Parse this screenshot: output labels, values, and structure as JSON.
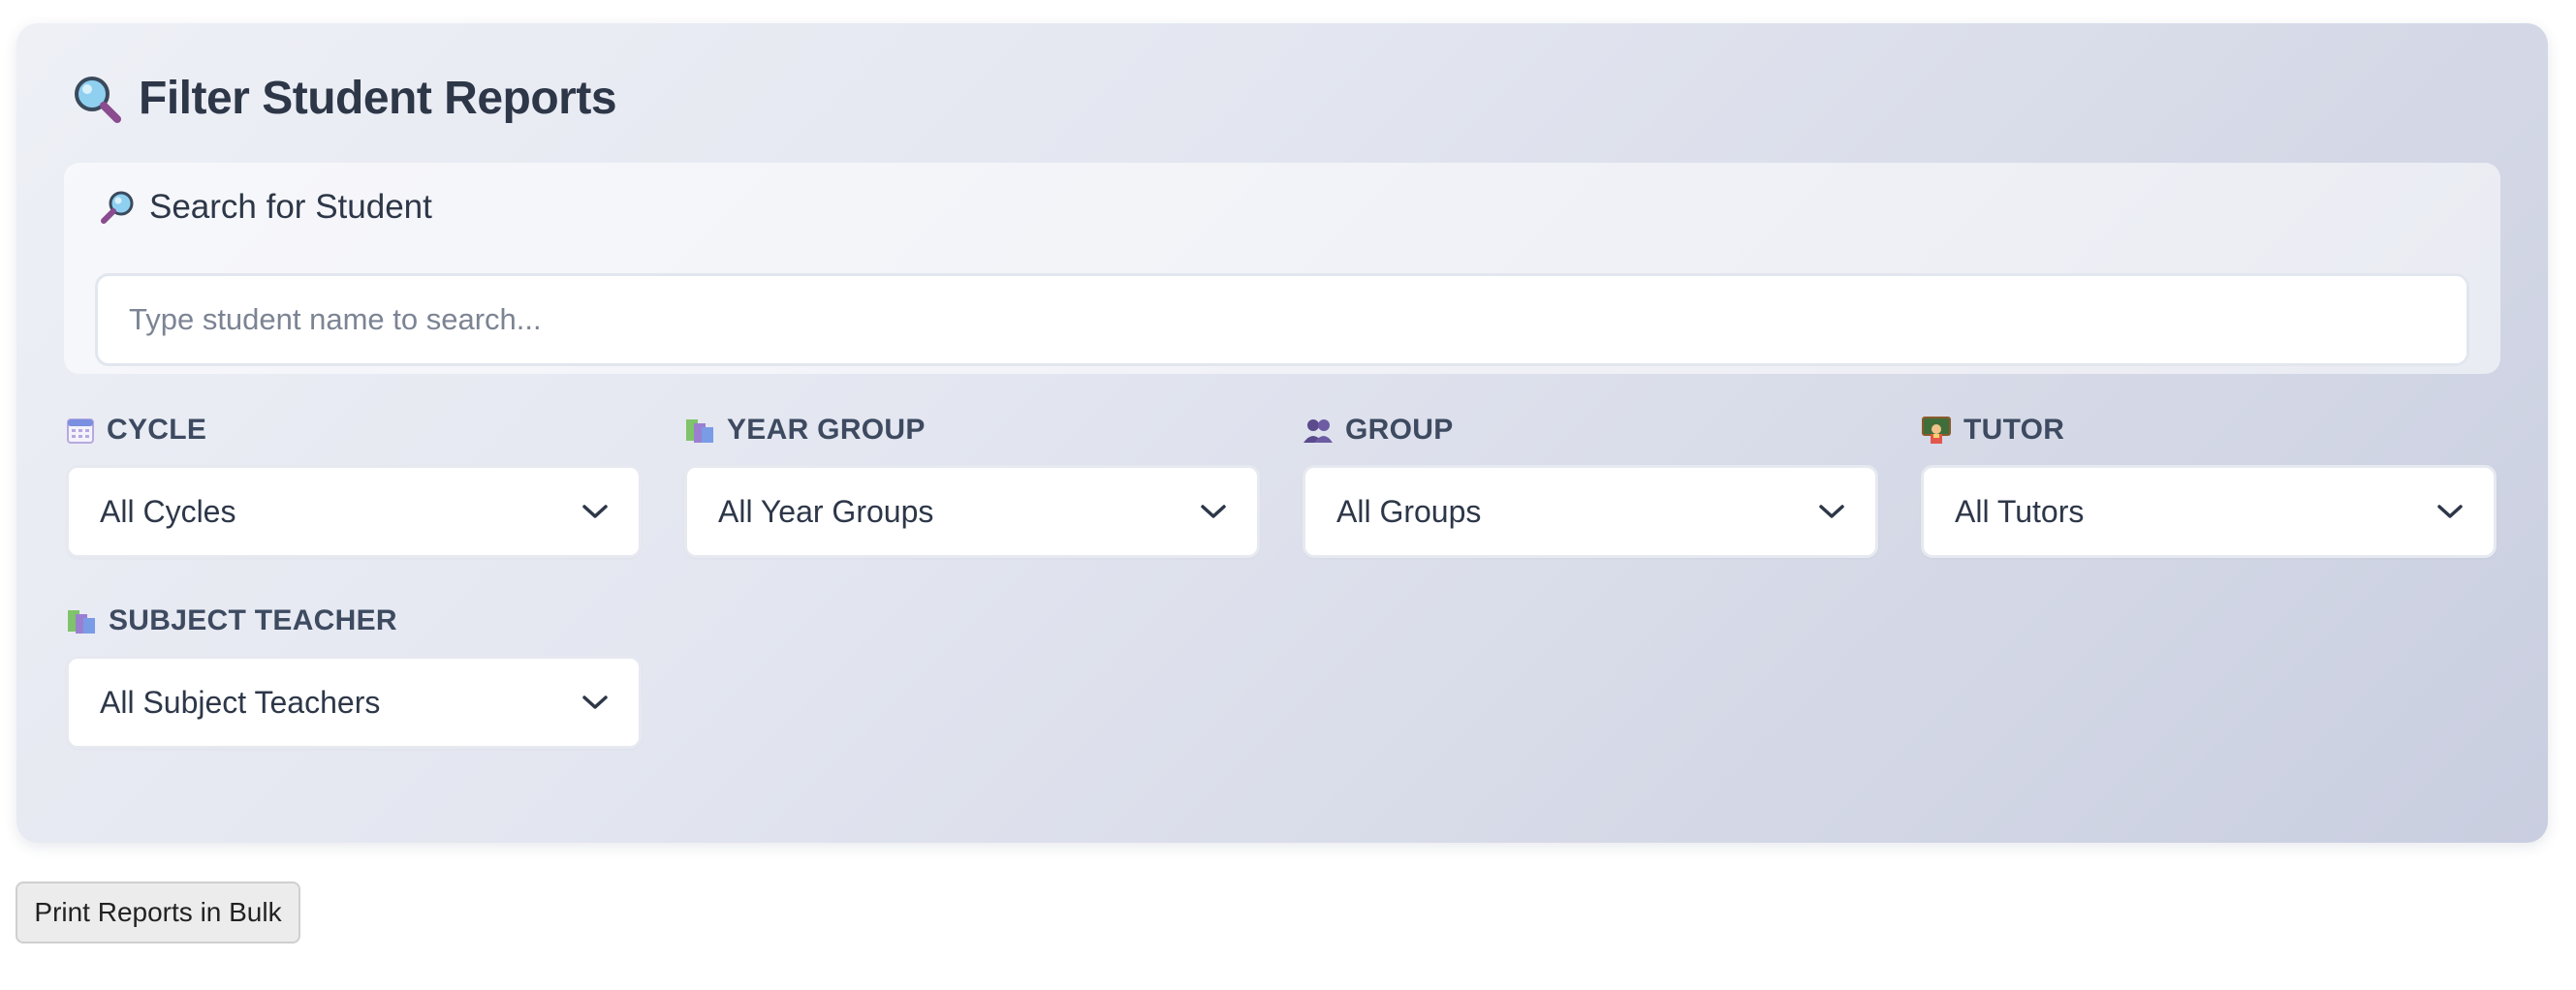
{
  "filter_panel": {
    "title": "Filter Student Reports",
    "title_icon": "magnifier-left-icon",
    "search": {
      "label": "Search for Student",
      "icon": "magnifier-right-icon",
      "placeholder": "Type student name to search...",
      "value": ""
    },
    "filters": [
      {
        "label": "CYCLE",
        "icon": "calendar-icon",
        "selected": "All Cycles"
      },
      {
        "label": "YEAR GROUP",
        "icon": "books-icon",
        "selected": "All Year Groups"
      },
      {
        "label": "GROUP",
        "icon": "people-icon",
        "selected": "All Groups"
      },
      {
        "label": "TUTOR",
        "icon": "teacher-icon",
        "selected": "All Tutors"
      },
      {
        "label": "SUBJECT TEACHER",
        "icon": "books-icon",
        "selected": "All Subject Teachers"
      }
    ]
  },
  "actions": {
    "bulk_print_label": "Print Reports in Bulk"
  },
  "colors": {
    "title_text": "#2d3748",
    "label_text": "#3d4a60",
    "placeholder_text": "#7c8494",
    "panel_gradient_start": "#eef0f6",
    "panel_gradient_end": "#c9cee0"
  }
}
